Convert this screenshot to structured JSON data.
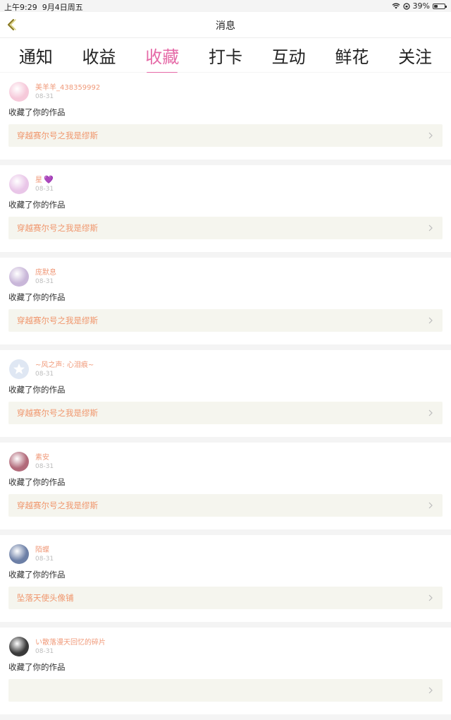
{
  "statusbar": {
    "time": "上午9:29",
    "date": "9月4日周五",
    "battery": "39%",
    "battery_level": 0.39
  },
  "nav": {
    "title": "消息"
  },
  "tabs": [
    {
      "label": "通知",
      "active": false
    },
    {
      "label": "收益",
      "active": false
    },
    {
      "label": "收藏",
      "active": true
    },
    {
      "label": "打卡",
      "active": false
    },
    {
      "label": "互动",
      "active": false
    },
    {
      "label": "鲜花",
      "active": false
    },
    {
      "label": "关注",
      "active": false
    }
  ],
  "items": [
    {
      "user": "美羊羊_438359992",
      "date": "08-31",
      "action": "收藏了你的作品",
      "work": "穿越赛尔号之我是缪斯",
      "avatar_color": "#f6c9da"
    },
    {
      "user": "星",
      "heart": "💜",
      "date": "08-31",
      "action": "收藏了你的作品",
      "work": "穿越赛尔号之我是缪斯",
      "avatar_color": "#e9c6e8"
    },
    {
      "user": "庞默息",
      "date": "08-31",
      "action": "收藏了你的作品",
      "work": "穿越赛尔号之我是缪斯",
      "avatar_color": "#c9b7d9"
    },
    {
      "user": "~风之声: 心泪痕~",
      "date": "08-31",
      "action": "收藏了你的作品",
      "work": "穿越赛尔号之我是缪斯",
      "avatar_color": "#dfe7f3"
    },
    {
      "user": "素安",
      "date": "08-31",
      "action": "收藏了你的作品",
      "work": "穿越赛尔号之我是缪斯",
      "avatar_color": "#b26a7a"
    },
    {
      "user": "陌蝶",
      "date": "08-31",
      "action": "收藏了你的作品",
      "work": "坠落天使头像铺",
      "avatar_color": "#6c7fa6"
    },
    {
      "user": "い散落漫天回忆的碎片",
      "date": "08-31",
      "action": "收藏了你的作品",
      "work": "",
      "avatar_color": "#3a3a3a"
    }
  ],
  "colors": {
    "accent": "#e56aa7",
    "username": "#f09a7a",
    "work_title": "#f0956b",
    "work_bg": "#f5f5ee"
  }
}
